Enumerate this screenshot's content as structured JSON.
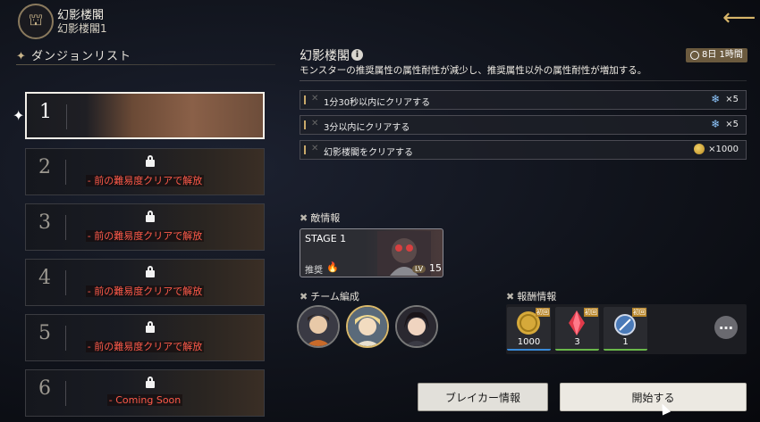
{
  "header": {
    "title": "幻影楼閣",
    "subtitle": "幻影楼閣1"
  },
  "dungeon_list": {
    "heading": "ダンジョンリスト",
    "items": [
      {
        "number": "1",
        "condition": ""
      },
      {
        "number": "2",
        "condition": "- 前の難易度クリアで解放"
      },
      {
        "number": "3",
        "condition": "- 前の難易度クリアで解放"
      },
      {
        "number": "4",
        "condition": "- 前の難易度クリアで解放"
      },
      {
        "number": "5",
        "condition": "- 前の難易度クリアで解放"
      },
      {
        "number": "6",
        "condition": "- Coming Soon"
      }
    ]
  },
  "detail": {
    "title": "幻影楼閣",
    "time_remaining": "8日 1時間",
    "description": "モンスターの推奨属性の属性耐性が減少し、推奨属性以外の属性耐性が増加する。",
    "missions": [
      {
        "text": "1分30秒以内にクリアする",
        "reward": "×5"
      },
      {
        "text": "3分以内にクリアする",
        "reward": "×5"
      },
      {
        "text": "幻影楼閣をクリアする",
        "reward": "×1000"
      }
    ],
    "enemy_heading": "敵情報",
    "stage": {
      "label": "STAGE 1",
      "recommended_label": "推奨",
      "level_label": "LV",
      "level": "15"
    },
    "team_heading": "チーム編成",
    "reward_heading": "報酬情報",
    "rewards": [
      {
        "tag": "初回",
        "count": "1000"
      },
      {
        "tag": "初回",
        "count": "3"
      },
      {
        "tag": "初回",
        "count": "1"
      }
    ]
  },
  "buttons": {
    "breaker_info": "ブレイカー情報",
    "start": "開始する"
  },
  "colors": {
    "accent_gold": "#d7b56a",
    "locked_text": "#ff5a4a",
    "timer_badge": "#6b5a3e"
  }
}
